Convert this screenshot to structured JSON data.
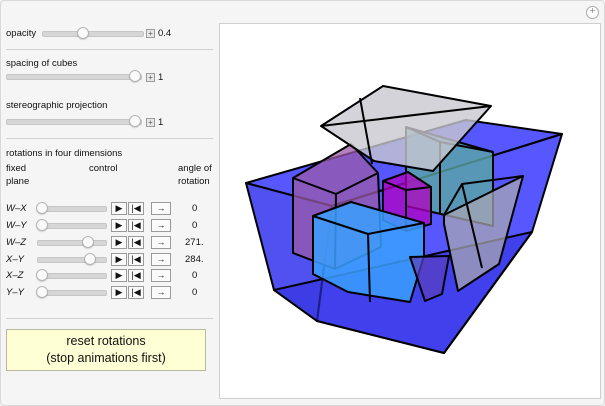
{
  "controls": {
    "opacity": {
      "label": "opacity",
      "value": "0.4",
      "level": 0.4
    },
    "spacing": {
      "label": "spacing of cubes",
      "value": "1"
    },
    "stereo": {
      "label": "stereographic projection",
      "value": "1"
    }
  },
  "rotations": {
    "title": "rotations in four dimensions",
    "col_fixed_1": "fixed",
    "col_fixed_2": "plane",
    "col_control": "control",
    "col_angle_1": "angle of",
    "col_angle_2": "rotation",
    "rows": [
      {
        "plane": "W–X",
        "angle": "0"
      },
      {
        "plane": "W–Y",
        "angle": "0"
      },
      {
        "plane": "W–Z",
        "angle": "271."
      },
      {
        "plane": "X–Y",
        "angle": "284."
      },
      {
        "plane": "X–Z",
        "angle": "0"
      },
      {
        "plane": "Y–Y",
        "angle": "0"
      }
    ],
    "play_glyph": "▶",
    "step_glyph": "|◀",
    "dir_glyph": "→"
  },
  "reset": {
    "line1": "reset rotations",
    "line2": "(stop animations first)"
  },
  "corner_icon": "+",
  "colors": {
    "blue": "#3a3aff",
    "purple": "#8a4aa0",
    "teal": "#4fa5a0",
    "lightblue": "#3aa0ff",
    "grey": "#9a9aa8",
    "magenta": "#b000c0"
  }
}
